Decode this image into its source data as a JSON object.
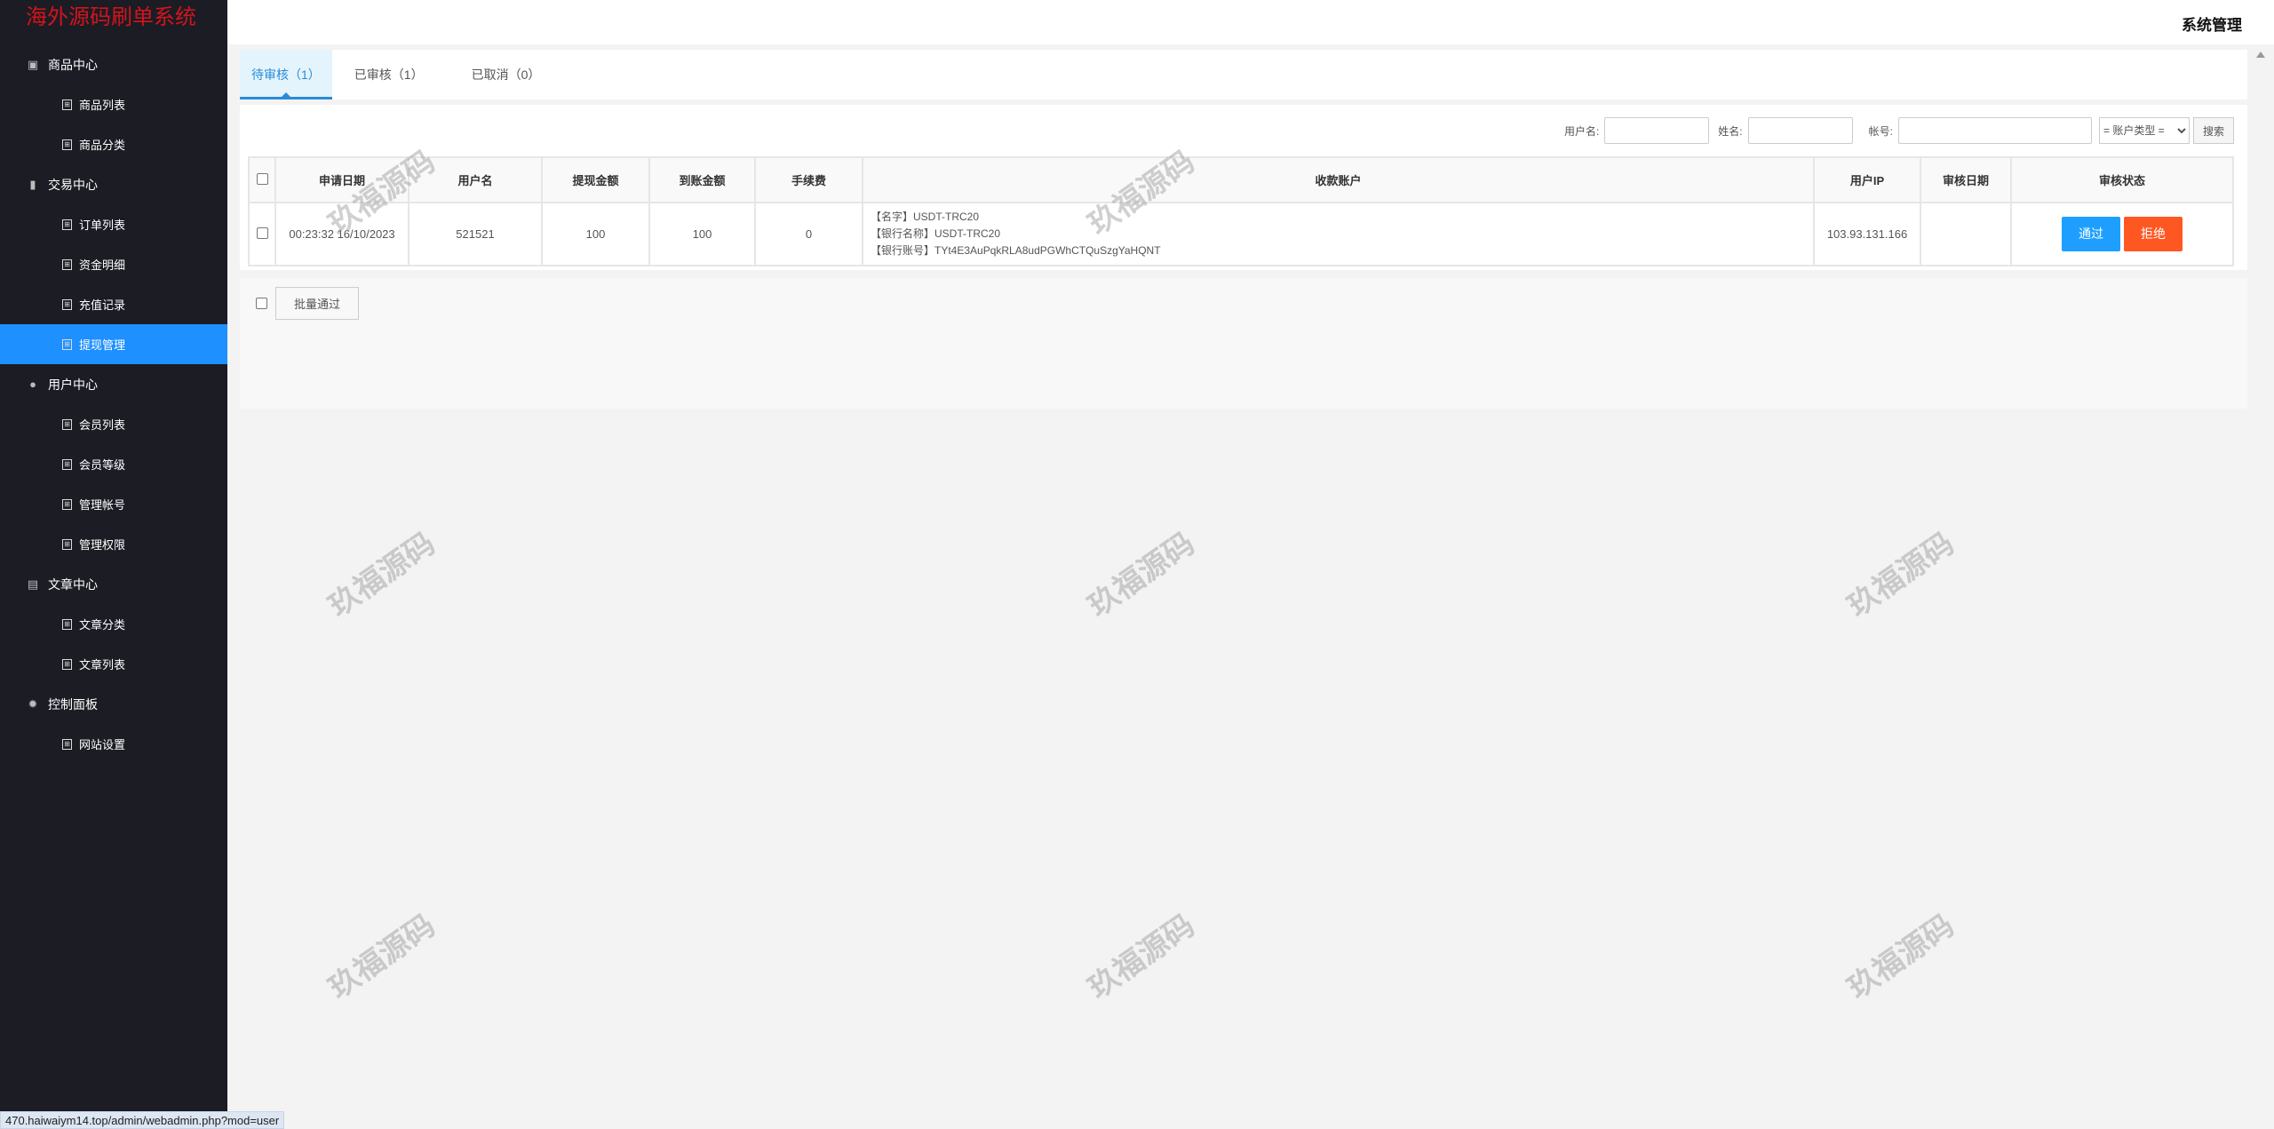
{
  "app_title": "海外源码刷单系统",
  "header": {
    "title": "系统管理"
  },
  "sidebar": [
    {
      "label": "商品中心",
      "type": "group",
      "icon": "bag-icon"
    },
    {
      "label": "商品列表",
      "type": "sub"
    },
    {
      "label": "商品分类",
      "type": "sub"
    },
    {
      "label": "交易中心",
      "type": "group",
      "icon": "bar-chart-icon"
    },
    {
      "label": "订单列表",
      "type": "sub"
    },
    {
      "label": "资金明细",
      "type": "sub"
    },
    {
      "label": "充值记录",
      "type": "sub"
    },
    {
      "label": "提现管理",
      "type": "sub",
      "active": true
    },
    {
      "label": "用户中心",
      "type": "group",
      "icon": "user-icon"
    },
    {
      "label": "会员列表",
      "type": "sub"
    },
    {
      "label": "会员等级",
      "type": "sub"
    },
    {
      "label": "管理帐号",
      "type": "sub"
    },
    {
      "label": "管理权限",
      "type": "sub"
    },
    {
      "label": "文章中心",
      "type": "group",
      "icon": "document-icon"
    },
    {
      "label": "文章分类",
      "type": "sub"
    },
    {
      "label": "文章列表",
      "type": "sub"
    },
    {
      "label": "控制面板",
      "type": "group",
      "icon": "gear-icon"
    },
    {
      "label": "网站设置",
      "type": "sub"
    }
  ],
  "tabs": [
    {
      "label": "待审核（1）",
      "active": true
    },
    {
      "label": "已审核（1）"
    },
    {
      "label": "已取消（0）"
    }
  ],
  "search": {
    "username_label": "用户名:",
    "name_label": "姓名:",
    "account_label": "帐号:",
    "type_select": "= 账户类型 =",
    "search_button": "搜索"
  },
  "table": {
    "headers": [
      "申请日期",
      "用户名",
      "提现金额",
      "到账金额",
      "手续费",
      "收款账户",
      "用户IP",
      "审核日期",
      "审核状态"
    ],
    "rows": [
      {
        "date": "00:23:32 16/10/2023",
        "username": "521521",
        "amount": "100",
        "received": "100",
        "fee": "0",
        "account_lines": [
          "【名字】USDT-TRC20",
          "【银行名称】USDT-TRC20",
          "【银行账号】TYt4E3AuPqkRLA8udPGWhCTQuSzgYaHQNT"
        ],
        "ip": "103.93.131.166",
        "review_date": "",
        "pass_label": "通过",
        "reject_label": "拒绝"
      }
    ]
  },
  "batch_button": "批量通过",
  "watermark": "玖福源码",
  "status_url": "470.haiwaiym14.top/admin/webadmin.php?mod=user",
  "colors": {
    "sidebar": "#1b1c24",
    "active": "#1e90ff",
    "pass": "#1e9fff",
    "reject": "#ff5722",
    "logo": "#d3141c"
  }
}
